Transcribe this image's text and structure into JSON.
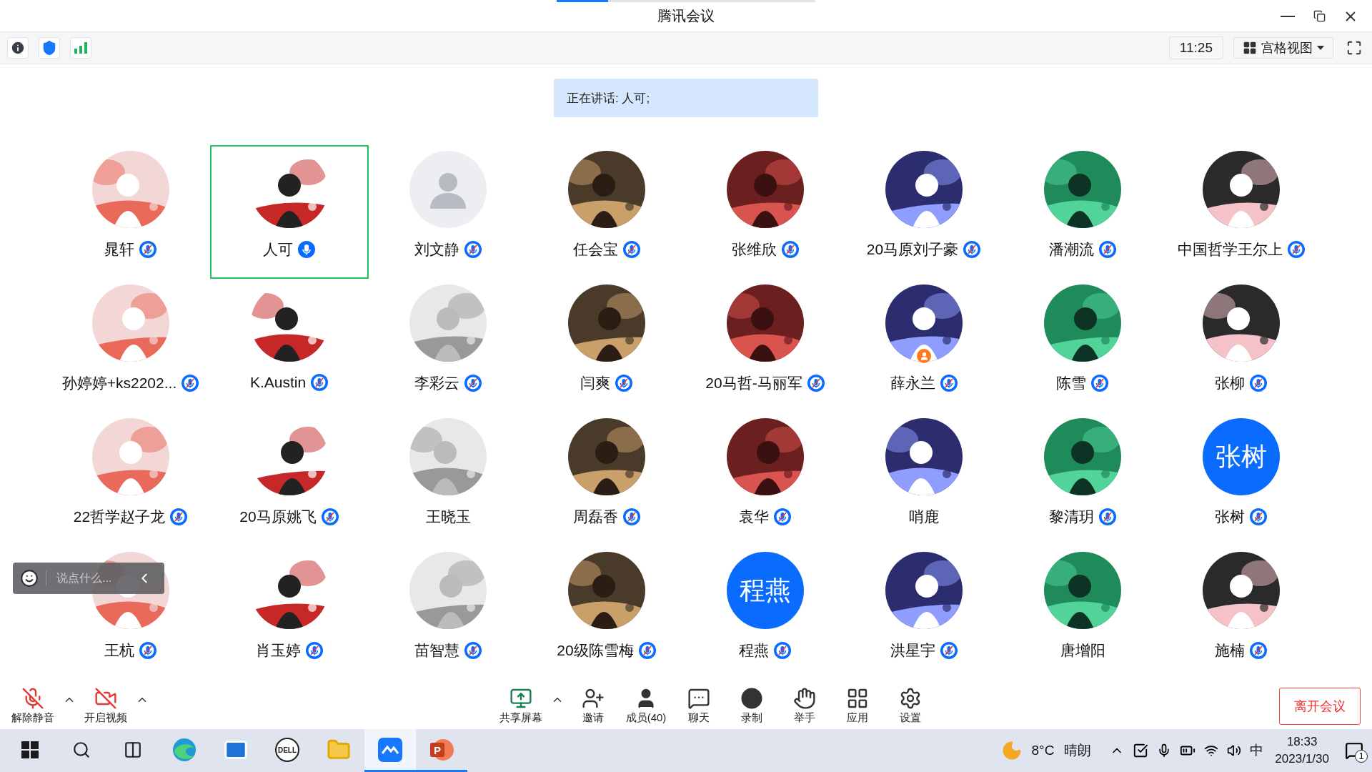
{
  "window": {
    "title": "腾讯会议"
  },
  "info_bar": {
    "time": "11:25",
    "view": "宫格视图"
  },
  "speaking": "正在讲话: 人可;",
  "participants": [
    {
      "name": "晁轩",
      "kind": "picture",
      "mic_shown": true,
      "muted": true,
      "selected": false,
      "host": false
    },
    {
      "name": "人可",
      "kind": "picture",
      "mic_shown": true,
      "muted": false,
      "selected": true,
      "host": false
    },
    {
      "name": "刘文静",
      "kind": "default",
      "mic_shown": true,
      "muted": true,
      "selected": false,
      "host": false
    },
    {
      "name": "任会宝",
      "kind": "picture",
      "mic_shown": true,
      "muted": true,
      "selected": false,
      "host": false
    },
    {
      "name": "张维欣",
      "kind": "picture",
      "mic_shown": true,
      "muted": true,
      "selected": false,
      "host": false
    },
    {
      "name": "20马原刘子豪",
      "kind": "picture",
      "mic_shown": true,
      "muted": true,
      "selected": false,
      "host": false
    },
    {
      "name": "潘潮流",
      "kind": "picture",
      "mic_shown": true,
      "muted": true,
      "selected": false,
      "host": false
    },
    {
      "name": "中国哲学王尔上",
      "kind": "picture",
      "mic_shown": true,
      "muted": true,
      "selected": false,
      "host": false
    },
    {
      "name": "孙婷婷+ks2202...",
      "kind": "picture",
      "mic_shown": true,
      "muted": true,
      "selected": false,
      "host": false
    },
    {
      "name": "K.Austin",
      "kind": "picture",
      "mic_shown": true,
      "muted": true,
      "selected": false,
      "host": false
    },
    {
      "name": "李彩云",
      "kind": "picture",
      "mic_shown": true,
      "muted": true,
      "selected": false,
      "host": false
    },
    {
      "name": "闫爽",
      "kind": "picture",
      "mic_shown": true,
      "muted": true,
      "selected": false,
      "host": false
    },
    {
      "name": "20马哲-马丽军",
      "kind": "picture",
      "mic_shown": true,
      "muted": true,
      "selected": false,
      "host": false
    },
    {
      "name": "薛永兰",
      "kind": "picture",
      "mic_shown": true,
      "muted": true,
      "selected": false,
      "host": true
    },
    {
      "name": "陈雪",
      "kind": "picture",
      "mic_shown": true,
      "muted": true,
      "selected": false,
      "host": false
    },
    {
      "name": "张柳",
      "kind": "picture",
      "mic_shown": true,
      "muted": true,
      "selected": false,
      "host": false
    },
    {
      "name": "22哲学赵子龙",
      "kind": "picture",
      "mic_shown": true,
      "muted": true,
      "selected": false,
      "host": false
    },
    {
      "name": "20马原姚飞",
      "kind": "picture",
      "mic_shown": true,
      "muted": true,
      "selected": false,
      "host": false
    },
    {
      "name": "王晓玉",
      "kind": "picture",
      "mic_shown": false,
      "selected": false,
      "host": false
    },
    {
      "name": "周磊香",
      "kind": "picture",
      "mic_shown": true,
      "muted": true,
      "selected": false,
      "host": false
    },
    {
      "name": "袁华",
      "kind": "picture",
      "mic_shown": true,
      "muted": true,
      "selected": false,
      "host": false
    },
    {
      "name": "哨鹿",
      "kind": "picture",
      "mic_shown": false,
      "selected": false,
      "host": false
    },
    {
      "name": "黎清玥",
      "kind": "picture",
      "mic_shown": true,
      "muted": true,
      "selected": false,
      "host": false
    },
    {
      "name": "张树",
      "kind": "initials",
      "avatar_text": "张树",
      "mic_shown": true,
      "muted": true,
      "selected": false,
      "host": false
    },
    {
      "name": "王杭",
      "kind": "picture",
      "mic_shown": true,
      "muted": true,
      "selected": false,
      "host": false
    },
    {
      "name": "肖玉婷",
      "kind": "picture",
      "mic_shown": true,
      "muted": true,
      "selected": false,
      "host": false
    },
    {
      "name": "苗智慧",
      "kind": "picture",
      "mic_shown": true,
      "muted": true,
      "selected": false,
      "host": false
    },
    {
      "name": "20级陈雪梅",
      "kind": "picture",
      "mic_shown": true,
      "muted": true,
      "selected": false,
      "host": false
    },
    {
      "name": "程燕",
      "kind": "initials",
      "avatar_text": "程燕",
      "mic_shown": true,
      "muted": true,
      "selected": false,
      "host": false
    },
    {
      "name": "洪星宇",
      "kind": "picture",
      "mic_shown": true,
      "muted": true,
      "selected": false,
      "host": false
    },
    {
      "name": "唐增阳",
      "kind": "picture",
      "mic_shown": false,
      "selected": false,
      "host": false
    },
    {
      "name": "施楠",
      "kind": "picture",
      "mic_shown": true,
      "muted": true,
      "selected": false,
      "host": false
    }
  ],
  "chat_input": {
    "placeholder": "说点什么..."
  },
  "toolbar": [
    {
      "kind": "mic",
      "label": "解除静音",
      "caret": true
    },
    {
      "kind": "video",
      "label": "开启视频",
      "caret": true
    },
    {
      "kind": "share",
      "label": "共享屏幕",
      "caret": true
    },
    {
      "kind": "invite",
      "label": "邀请",
      "caret": false
    },
    {
      "kind": "members",
      "label": "成员(40)",
      "caret": false
    },
    {
      "kind": "chat",
      "label": "聊天",
      "caret": false
    },
    {
      "kind": "record",
      "label": "录制",
      "caret": false
    },
    {
      "kind": "hand",
      "label": "举手",
      "caret": false
    },
    {
      "kind": "apps",
      "label": "应用",
      "caret": false
    },
    {
      "kind": "settings",
      "label": "设置",
      "caret": false
    }
  ],
  "leave_button": "离开会议",
  "taskbar": {
    "apps": [
      {
        "kind": "start",
        "selected": false,
        "running": false
      },
      {
        "kind": "search",
        "selected": false,
        "running": false
      },
      {
        "kind": "taskview",
        "selected": false,
        "running": false
      },
      {
        "kind": "browser",
        "selected": false,
        "running": false
      },
      {
        "kind": "mail",
        "selected": false,
        "running": false
      },
      {
        "kind": "logo",
        "text": "DELL",
        "selected": false,
        "running": false
      },
      {
        "kind": "folder",
        "selected": false,
        "running": false
      },
      {
        "kind": "meeting",
        "selected": true,
        "running": true
      },
      {
        "kind": "slides",
        "text": "P",
        "selected": false,
        "running": true
      }
    ],
    "temperature": "8°C",
    "weather": "晴朗",
    "ime": "中",
    "time": "18:33",
    "date": "2023/1/30",
    "notifications": "1"
  }
}
